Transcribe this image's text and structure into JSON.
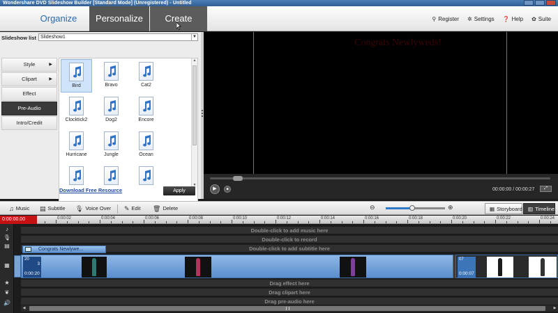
{
  "window": {
    "title": "Wondershare DVD Slideshow Builder [Standard Mode] (Unregistered) - Untitled"
  },
  "nav": {
    "tabs": [
      "Organize",
      "Personalize",
      "Create"
    ],
    "right": [
      {
        "icon": "register-icon",
        "label": "Register"
      },
      {
        "icon": "gear-icon",
        "label": "Settings"
      },
      {
        "icon": "help-icon",
        "label": "Help"
      },
      {
        "icon": "suite-icon",
        "label": "Suite"
      }
    ]
  },
  "slideshow": {
    "label": "Slideshow list :",
    "selected": "Slideshow1"
  },
  "categories": [
    {
      "label": "Style",
      "arrow": "▶"
    },
    {
      "label": "Clipart",
      "arrow": "▶"
    },
    {
      "label": "Effect",
      "arrow": ""
    },
    {
      "label": "Pre-Audio",
      "arrow": ""
    },
    {
      "label": "Intro/Credit",
      "arrow": ""
    }
  ],
  "audio_items": [
    "Bird",
    "Bravo",
    "Cat2",
    "Clocktick2",
    "Dog2",
    "Encore",
    "Hurricane",
    "Jungle",
    "Ocean",
    "",
    "",
    ""
  ],
  "grid_footer": {
    "download": "Download Free Resource",
    "apply": "Apply"
  },
  "preview": {
    "text": "Congrats Newlyweds!",
    "time": "00:00:00 / 00:00:27"
  },
  "timeline_toolbar": {
    "music": "Music",
    "subtitle": "Subtitle",
    "voiceover": "Voice Over",
    "edit": "Edit",
    "delete": "Delete",
    "storyboard": "Storyboard",
    "timeline": "Timeline",
    "zoom_level": 0.45
  },
  "ruler": {
    "timecode": "0:00:00.00",
    "ticks": [
      "0:00:02",
      "0:00:04",
      "0:00:06",
      "0:00:08",
      "0:00:10",
      "0:00:12",
      "0:00:14",
      "0:00:16",
      "0:00:18",
      "0:00:20",
      "0:00:22",
      "0:00:24"
    ]
  },
  "tracks": {
    "music_hint": "Double-click to add music here",
    "record_hint": "Double-click to record",
    "subtitle_hint": "Double-click to add subtitle here",
    "subtitle_clip": "Congrats Newlywe...",
    "effect_hint": "Drag effect here",
    "clipart_hint": "Drag clipart here",
    "preaudio_hint": "Drag pre-audio here",
    "clip1_num": "20",
    "clip1_dur": "0:00:20",
    "clip2_num": "07",
    "clip2_dur": "0:00:07"
  }
}
